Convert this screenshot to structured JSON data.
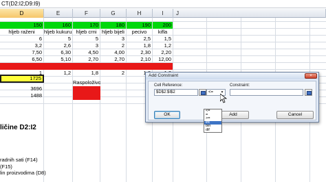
{
  "formula_bar": {
    "text": "CT(D2:I2;D9:I9)"
  },
  "columns": [
    {
      "letter": "D",
      "selected": true
    },
    {
      "letter": "E",
      "selected": false
    },
    {
      "letter": "F",
      "selected": false
    },
    {
      "letter": "G",
      "selected": false
    },
    {
      "letter": "H",
      "selected": false
    },
    {
      "letter": "I",
      "selected": false
    },
    {
      "letter": "J",
      "selected": false
    }
  ],
  "sheet": {
    "prices": [
      "150",
      "160",
      "170",
      "180",
      "190",
      "200"
    ],
    "products": [
      "hljeb raženi",
      "hljeb kukuruzni",
      "hljeb crni",
      "hljeb bijeli",
      "pecivo",
      "kifla"
    ],
    "rows": [
      [
        "6",
        "5",
        "5",
        "3",
        "2,5",
        "1,5"
      ],
      [
        "3,2",
        "2,6",
        "3",
        "2",
        "1,8",
        "1,2"
      ],
      [
        "7,50",
        "6,30",
        "4,50",
        "4,00",
        "2,30",
        "2,20"
      ],
      [
        "6,50",
        "5,10",
        "2,70",
        "2,70",
        "2,10",
        "12,00"
      ]
    ],
    "red_row": [
      "",
      "",
      "",
      "",
      "",
      ""
    ],
    "last_row": [
      "1",
      "1,2",
      "1,8",
      "2",
      "1,8",
      "1,2"
    ],
    "objective": "1725",
    "raspolozivo_label": "Raspoloživo",
    "lhs_values": [
      "3696",
      "1488"
    ],
    "title_fragment": "ličine  D2:I2",
    "notes": [
      "radnih sati (F14)",
      "(F15)",
      "lin proizvodima (D8)"
    ]
  },
  "dialog": {
    "title": "Add Constraint",
    "close_label": "×",
    "cell_reference_label": "Cell Reference:",
    "cell_reference_value": "$D$2:$I$2",
    "operator_value": "<=",
    "constraint_label": "Constraint:",
    "constraint_value": "",
    "ok_label": "OK",
    "add_label": "Add",
    "cancel_label": "Cancel",
    "operator_options": [
      "<=",
      "=",
      ">=",
      "int",
      "bin",
      "dif"
    ],
    "highlighted_option": 3
  }
}
